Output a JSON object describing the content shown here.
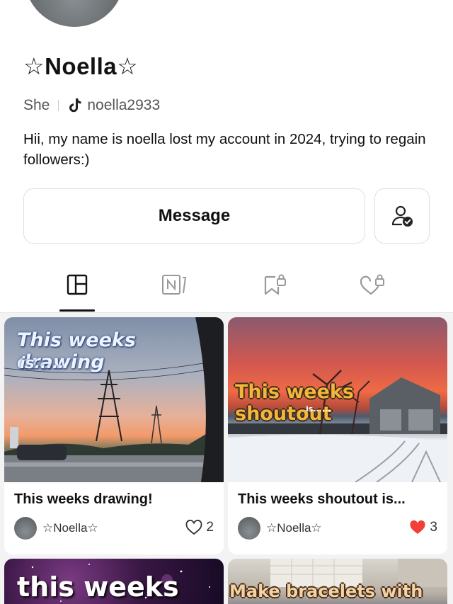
{
  "profile": {
    "name": "☆Noella☆",
    "pronoun": "She",
    "tiktok_handle": "noella2933",
    "bio": "Hii, my name is noella lost my account in 2024, trying to regain followers:)"
  },
  "actions": {
    "message_label": "Message"
  },
  "tabs": [
    {
      "icon": "grid-icon",
      "active": true
    },
    {
      "icon": "notes-icon",
      "active": false
    },
    {
      "icon": "bookmark-lock-icon",
      "active": false
    },
    {
      "icon": "heart-lock-icon",
      "active": false
    }
  ],
  "posts": [
    {
      "title": "This weeks drawing!",
      "author": "☆Noella☆",
      "likes": "2",
      "liked": false,
      "overlay_line1": "This weeks drawing",
      "overlay_line2": "is....."
    },
    {
      "title": "This weeks shoutout is...",
      "author": "☆Noella☆",
      "likes": "3",
      "liked": true,
      "overlay_line1": "This weeks shoutout",
      "overlay_line2": "is......"
    },
    {
      "overlay_line1": "this weeks"
    },
    {
      "overlay_line1": "Make bracelets with me"
    }
  ],
  "colors": {
    "accent_like": "#f23f37",
    "border": "#dedede",
    "text_muted": "#555555"
  }
}
